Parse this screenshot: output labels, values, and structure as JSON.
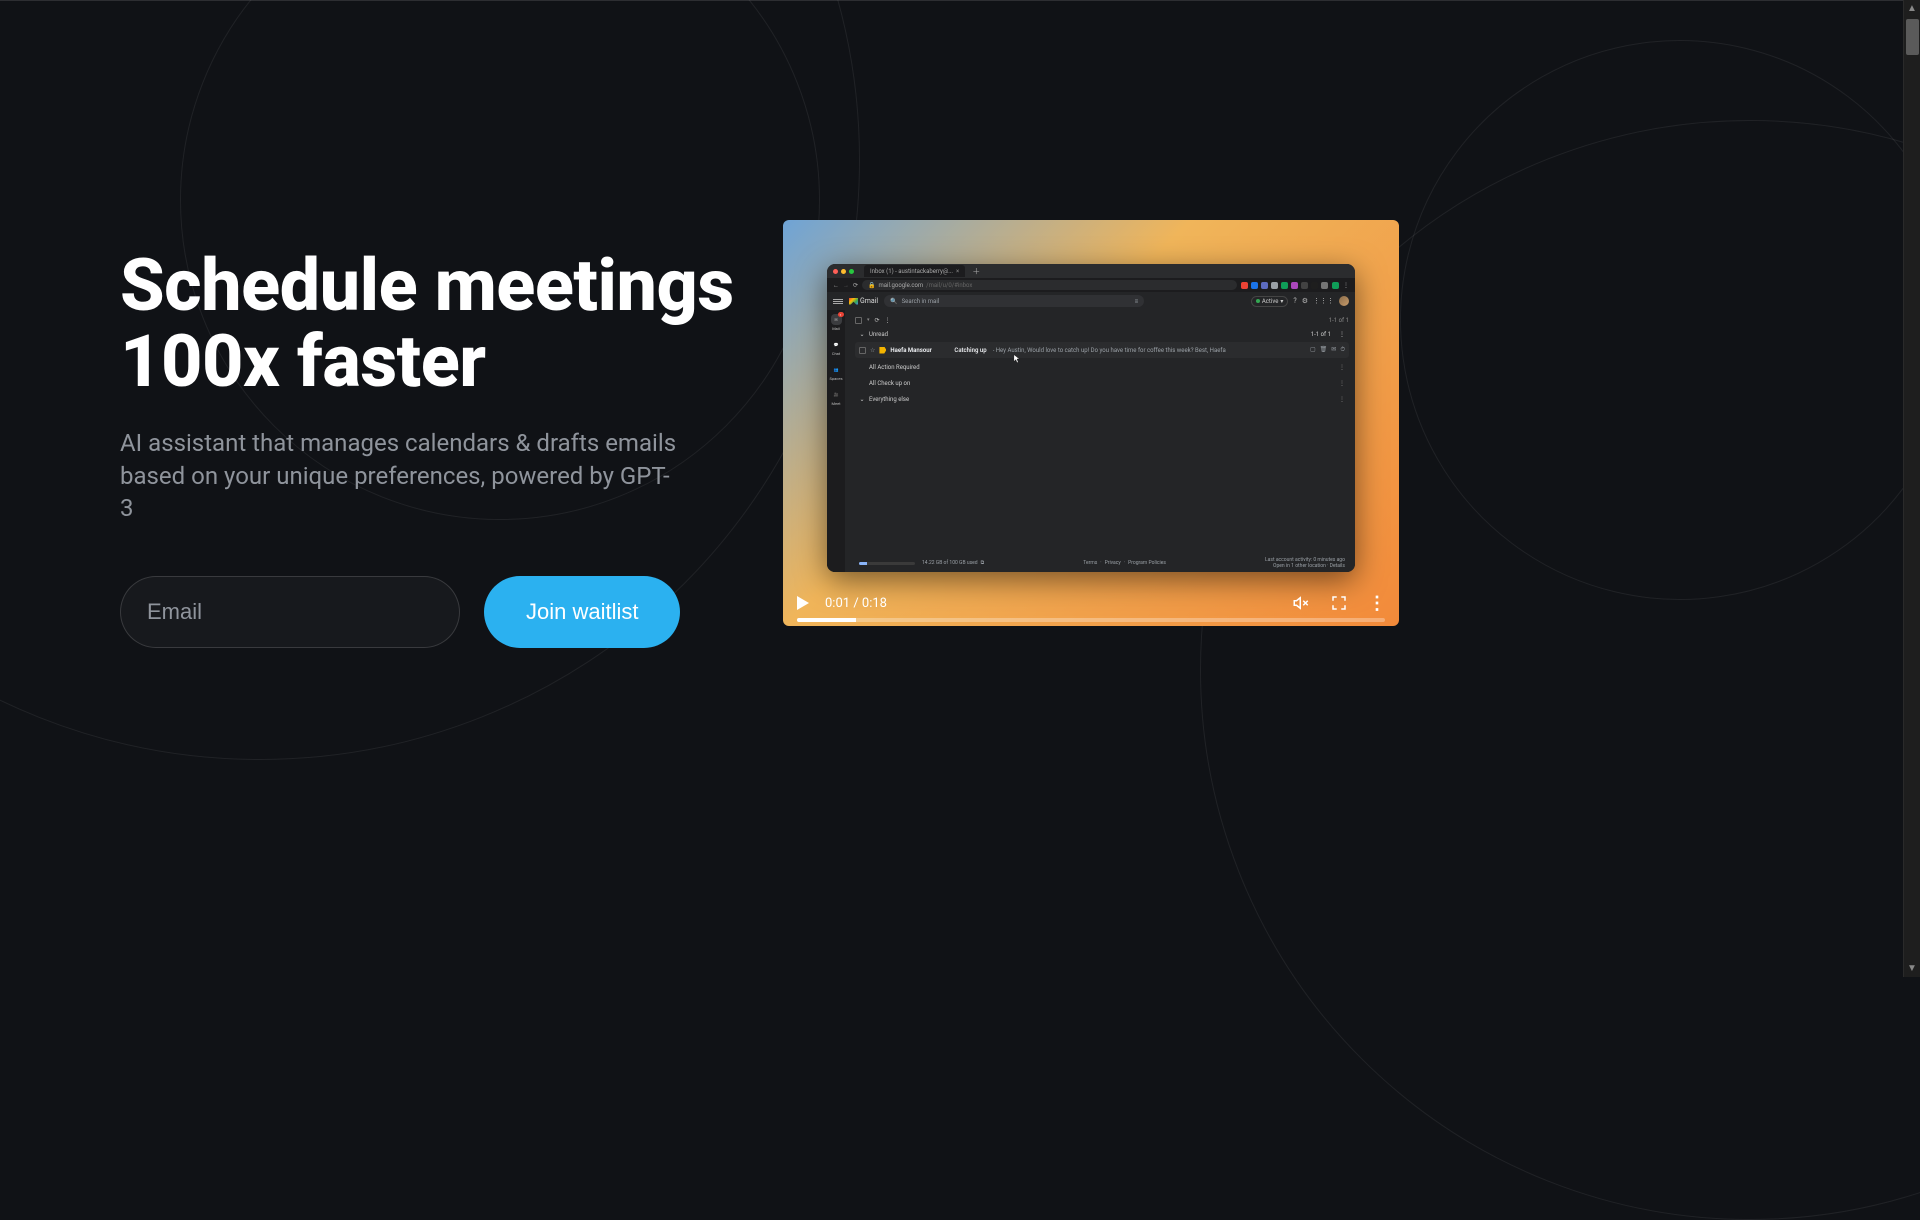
{
  "hero": {
    "title_line1": "Schedule meetings",
    "title_line2": "100x faster",
    "subtitle": "AI assistant that manages calendars & drafts emails based on your unique preferences, powered by GPT-3"
  },
  "cta": {
    "email_placeholder": "Email",
    "button_label": "Join waitlist"
  },
  "video": {
    "time_current": "0:01",
    "time_total": "0:18"
  },
  "browser": {
    "tab_title": "Inbox (1) - austintackaberry@...",
    "url_host": "mail.google.com",
    "url_path": "/mail/u/0/#inbox",
    "extension_colors": [
      "#ea4335",
      "#1a73e8",
      "#5c6bc0",
      "#9aa0a6",
      "#0f9d58",
      "#ab47bc",
      "#424242",
      "#1e1e1e",
      "#757575"
    ],
    "share_color": "#0f9d58"
  },
  "gmail": {
    "brand": "Gmail",
    "search_placeholder": "Search in mail",
    "status": "Active",
    "nav": [
      {
        "label": "Mail"
      },
      {
        "label": "Chat"
      },
      {
        "label": "Spaces"
      },
      {
        "label": "Meet"
      }
    ],
    "mail_badge": "1",
    "toolbar": {
      "count": "1-1 of 1"
    },
    "unread_header": "Unread",
    "email": {
      "sender": "Haefa Mansour",
      "subject": "Catching up",
      "snippet": " - Hey Austin, Would love to catch up! Do you have time for coffee this week? Best, Haefa"
    },
    "sections": [
      {
        "label": "All Action Required"
      },
      {
        "label": "All Check up on"
      },
      {
        "label": "Everything else"
      }
    ],
    "footer": {
      "storage_text": "14.22 GB of 100 GB used",
      "links": [
        "Terms",
        "Privacy",
        "Program Policies"
      ],
      "activity_line1": "Last account activity: 0 minutes ago",
      "activity_line2": "Open in 1 other location · Details"
    }
  }
}
